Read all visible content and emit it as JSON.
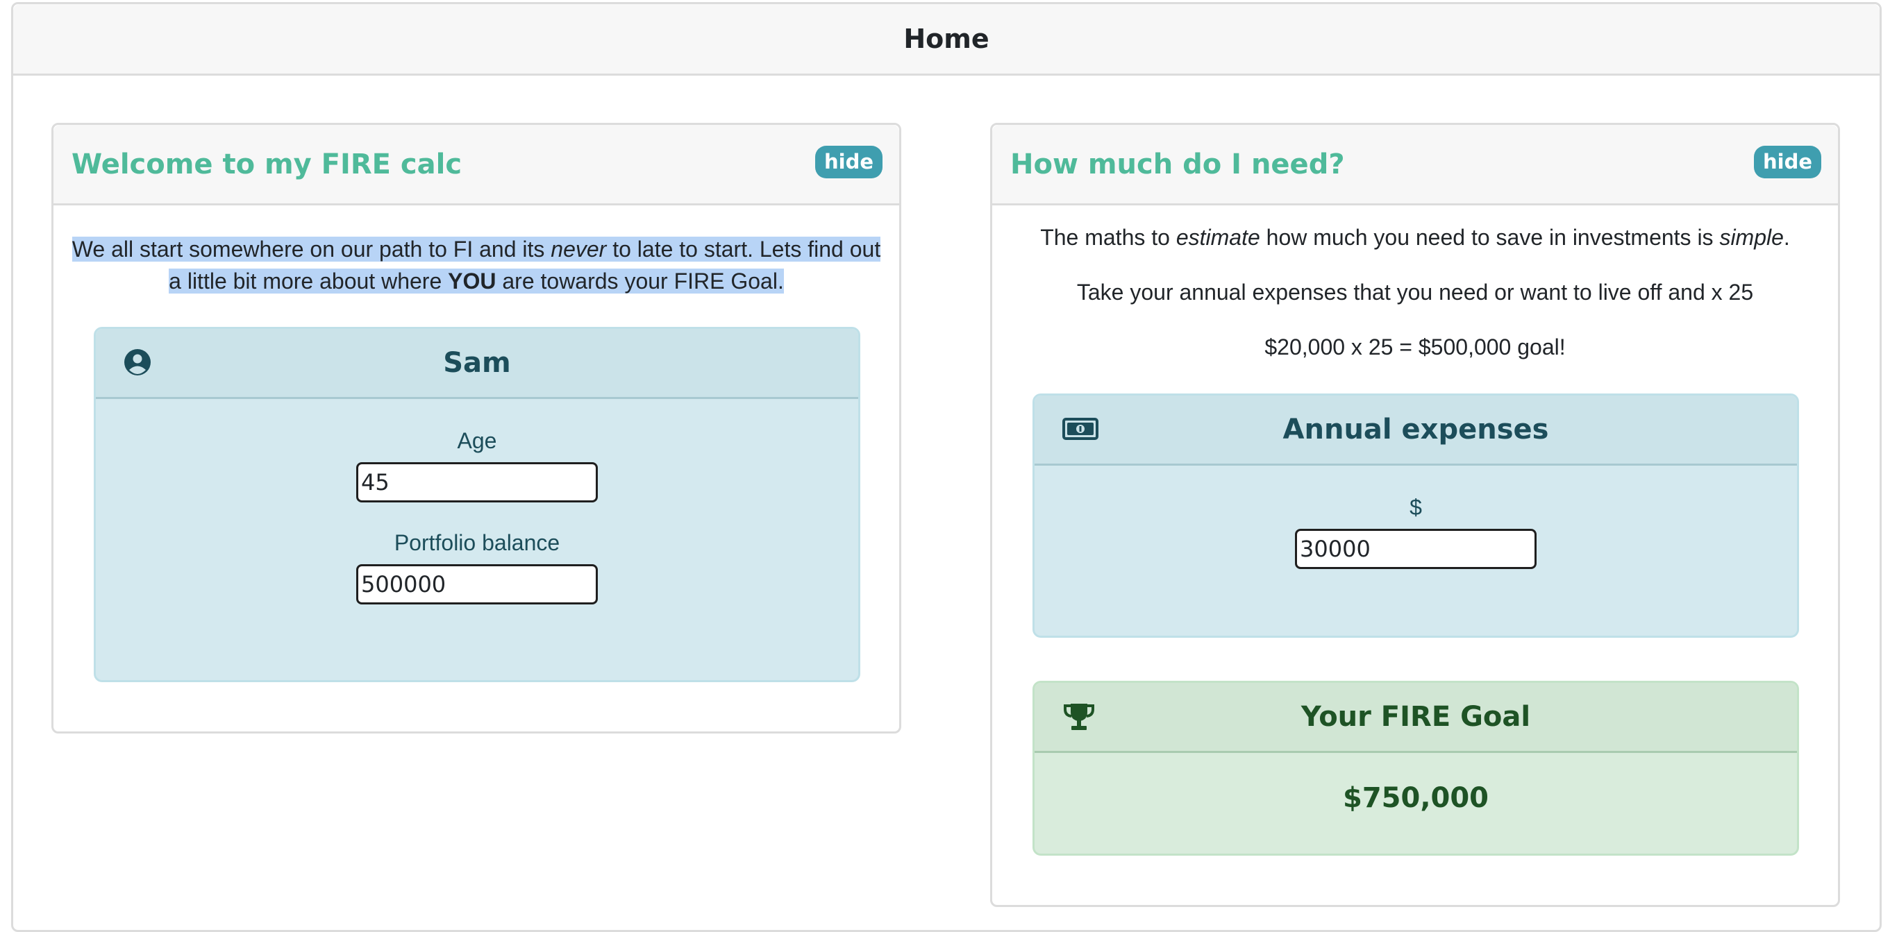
{
  "header": {
    "title": "Home"
  },
  "welcome": {
    "title": "Welcome to my FIRE calc",
    "hide_label": "hide",
    "intro": {
      "p1": "We all start somewhere on our path to FI and its ",
      "em": "never",
      "p2": " to late to start. Lets find out a little bit more about where ",
      "strong": "YOU",
      "p3": " are towards your FIRE Goal."
    },
    "profile": {
      "name": "Sam",
      "icon": "user-circle-icon",
      "age_label": "Age",
      "age_value": "45",
      "portfolio_label": "Portfolio balance",
      "portfolio_value": "500000"
    }
  },
  "need": {
    "title": "How much do I need?",
    "hide_label": "hide",
    "line1": {
      "p1": "The maths to ",
      "em1": "estimate",
      "p2": " how much you need to save in investments is ",
      "em2": "simple",
      "p3": "."
    },
    "line2": "Take your annual expenses that you need or want to live off and x 25",
    "line3": "$20,000 x 25 = $500,000 goal!",
    "expenses": {
      "title": "Annual expenses",
      "icon": "money-bill-icon",
      "currency_label": "$",
      "value": "30000"
    },
    "goal": {
      "title": "Your FIRE Goal",
      "icon": "trophy-icon",
      "amount": "$750,000"
    }
  }
}
